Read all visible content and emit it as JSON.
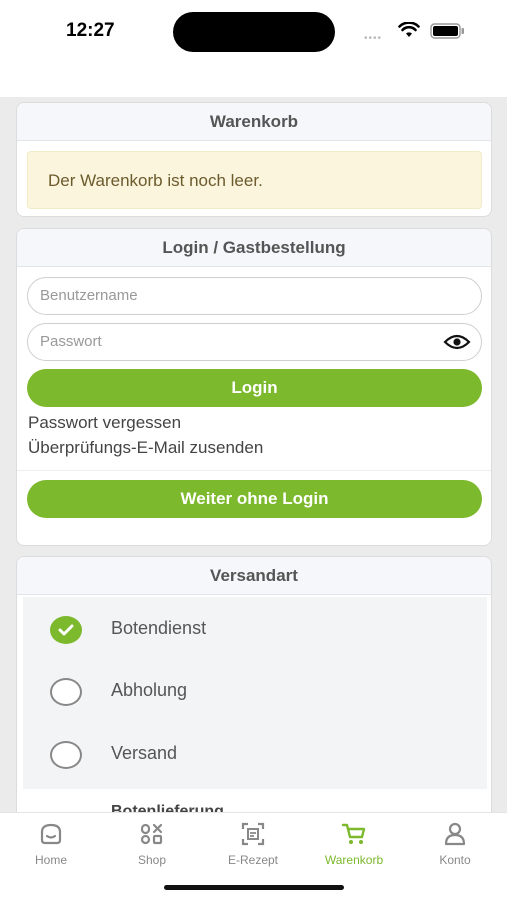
{
  "status": {
    "time": "12:27"
  },
  "cart": {
    "title": "Warenkorb",
    "empty_message": "Der Warenkorb ist noch leer."
  },
  "login": {
    "title": "Login / Gastbestellung",
    "username_placeholder": "Benutzername",
    "password_placeholder": "Passwort",
    "login_button": "Login",
    "forgot_password": "Passwort vergessen",
    "send_verification": "Überprüfungs-E-Mail zusenden",
    "guest_button": "Weiter ohne Login"
  },
  "shipping": {
    "title": "Versandart",
    "options": [
      {
        "label": "Botendienst",
        "selected": true
      },
      {
        "label": "Abholung",
        "selected": false
      },
      {
        "label": "Versand",
        "selected": false
      }
    ],
    "sub_heading": "Botenlieferung"
  },
  "tabbar": {
    "items": [
      {
        "label": "Home",
        "icon": "home-icon"
      },
      {
        "label": "Shop",
        "icon": "shop-icon"
      },
      {
        "label": "E-Rezept",
        "icon": "scan-icon"
      },
      {
        "label": "Warenkorb",
        "icon": "cart-icon",
        "active": true
      },
      {
        "label": "Konto",
        "icon": "user-icon"
      }
    ]
  },
  "colors": {
    "accent": "#7cb92c",
    "notice_bg": "#fbf5dd"
  }
}
